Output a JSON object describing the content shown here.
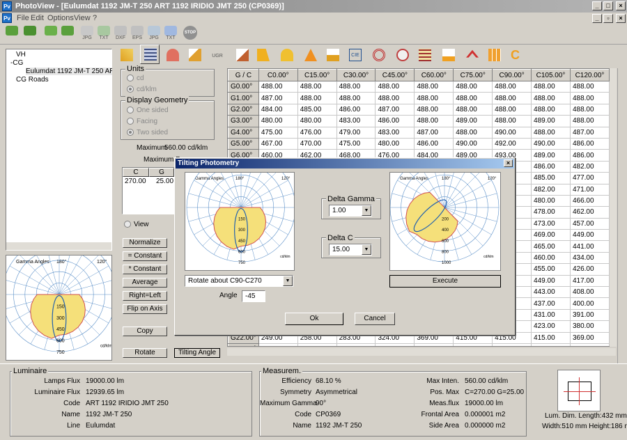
{
  "window": {
    "title": "PhotoView - [Eulumdat 1192 JM-T 250 ART 1192 IRIDIO JMT 250 (CP0369)]",
    "icon": "Pv"
  },
  "menu": [
    "File",
    "Edit",
    "Options",
    "View",
    "?"
  ],
  "toolbar": [
    {
      "icon": "user-green-icon",
      "label": ""
    },
    {
      "icon": "user-green-icon",
      "label": ""
    },
    {
      "icon": "users-icon",
      "label": ""
    },
    {
      "icon": "users-icon",
      "label": ""
    },
    {
      "icon": "export-jpg-icon",
      "label": "JPG"
    },
    {
      "icon": "export-txt-icon",
      "label": "TXT"
    },
    {
      "icon": "export-dxf-icon",
      "label": "DXF"
    },
    {
      "icon": "export-eps-icon",
      "label": "EPS"
    },
    {
      "icon": "export-jpg-icon",
      "label": "JPG"
    },
    {
      "icon": "export-txt-icon",
      "label": "TXT"
    },
    {
      "icon": "stop-icon",
      "label": "STOP"
    }
  ],
  "tree": {
    "items": [
      "VH",
      "CG",
      "Eulumdat 1192 JM-T 250 ART 1192",
      "CG Roads"
    ]
  },
  "units": {
    "title": "Units",
    "options": [
      "cd",
      "cd/klm"
    ]
  },
  "geometry": {
    "title": "Display Geometry",
    "options": [
      "One sided",
      "Facing",
      "Two sided"
    ]
  },
  "maximum": {
    "label": "Maximum",
    "value": "560.00 cd/klm",
    "pos_label": "Maximum Po"
  },
  "maxpos_table": {
    "headers": [
      "C",
      "G"
    ],
    "values": [
      "270.00",
      "25.00"
    ]
  },
  "view_label": "View",
  "side_buttons": [
    "Normalize",
    "= Constant",
    "* Constant",
    "Average",
    "Right=Left",
    "Flip on Axis",
    "Copy",
    "Rotate",
    "Tilting Angle"
  ],
  "grid": {
    "corner": "G / C",
    "columns": [
      "C0.00°",
      "C15.00°",
      "C30.00°",
      "C45.00°",
      "C60.00°",
      "C75.00°",
      "C90.00°",
      "C105.00°",
      "C120.00°"
    ],
    "rows": [
      {
        "g": "G0.00°",
        "v": [
          "488.00",
          "488.00",
          "488.00",
          "488.00",
          "488.00",
          "488.00",
          "488.00",
          "488.00",
          "488.00"
        ]
      },
      {
        "g": "G1.00°",
        "v": [
          "487.00",
          "488.00",
          "488.00",
          "488.00",
          "488.00",
          "488.00",
          "488.00",
          "488.00",
          "488.00"
        ]
      },
      {
        "g": "G2.00°",
        "v": [
          "484.00",
          "485.00",
          "486.00",
          "487.00",
          "488.00",
          "488.00",
          "488.00",
          "488.00",
          "488.00"
        ]
      },
      {
        "g": "G3.00°",
        "v": [
          "480.00",
          "480.00",
          "483.00",
          "486.00",
          "488.00",
          "489.00",
          "488.00",
          "489.00",
          "488.00"
        ]
      },
      {
        "g": "G4.00°",
        "v": [
          "475.00",
          "476.00",
          "479.00",
          "483.00",
          "487.00",
          "488.00",
          "490.00",
          "488.00",
          "487.00"
        ]
      },
      {
        "g": "G5.00°",
        "v": [
          "467.00",
          "470.00",
          "475.00",
          "480.00",
          "486.00",
          "490.00",
          "492.00",
          "490.00",
          "486.00"
        ]
      },
      {
        "g": "G6.00°",
        "v": [
          "460.00",
          "462.00",
          "468.00",
          "476.00",
          "484.00",
          "489.00",
          "493.00",
          "489.00",
          "486.00"
        ]
      },
      {
        "g": "",
        "v": [
          "",
          "",
          "",
          "",
          "",
          "",
          "",
          "486.00",
          "482.00"
        ]
      },
      {
        "g": "",
        "v": [
          "",
          "",
          "",
          "",
          "",
          "",
          "",
          "485.00",
          "477.00"
        ]
      },
      {
        "g": "",
        "v": [
          "",
          "",
          "",
          "",
          "",
          "",
          "",
          "482.00",
          "471.00"
        ]
      },
      {
        "g": "",
        "v": [
          "",
          "",
          "",
          "",
          "",
          "",
          "",
          "480.00",
          "466.00"
        ]
      },
      {
        "g": "",
        "v": [
          "",
          "",
          "",
          "",
          "",
          "",
          "",
          "478.00",
          "462.00"
        ]
      },
      {
        "g": "",
        "v": [
          "",
          "",
          "",
          "",
          "",
          "",
          "",
          "473.00",
          "457.00"
        ]
      },
      {
        "g": "",
        "v": [
          "",
          "",
          "",
          "",
          "",
          "",
          "",
          "469.00",
          "449.00"
        ]
      },
      {
        "g": "",
        "v": [
          "",
          "",
          "",
          "",
          "",
          "",
          "",
          "465.00",
          "441.00"
        ]
      },
      {
        "g": "",
        "v": [
          "",
          "",
          "",
          "",
          "",
          "",
          "",
          "460.00",
          "434.00"
        ]
      },
      {
        "g": "",
        "v": [
          "",
          "",
          "",
          "",
          "",
          "",
          "",
          "455.00",
          "426.00"
        ]
      },
      {
        "g": "",
        "v": [
          "",
          "",
          "",
          "",
          "",
          "",
          "",
          "449.00",
          "417.00"
        ]
      },
      {
        "g": "",
        "v": [
          "",
          "",
          "",
          "",
          "",
          "",
          "",
          "443.00",
          "408.00"
        ]
      },
      {
        "g": "",
        "v": [
          "",
          "",
          "",
          "",
          "",
          "",
          "",
          "437.00",
          "400.00"
        ]
      },
      {
        "g": "",
        "v": [
          "",
          "",
          "",
          "",
          "",
          "",
          "",
          "431.00",
          "391.00"
        ]
      },
      {
        "g": "",
        "v": [
          "",
          "",
          "",
          "",
          "",
          "",
          "",
          "423.00",
          "380.00"
        ]
      },
      {
        "g": "G22.00°",
        "v": [
          "249.00",
          "258.00",
          "283.00",
          "324.00",
          "369.00",
          "415.00",
          "415.00",
          "415.00",
          "369.00"
        ]
      },
      {
        "g": "G23.00°",
        "v": [
          "236.00",
          "245.00",
          "270.00",
          "311.00",
          "358.00",
          "408.00",
          "408.00",
          "407.00",
          "357.00"
        ]
      }
    ]
  },
  "polar": {
    "title": "Gamma Angles",
    "top_labels": [
      "180°",
      "120°"
    ],
    "angle_labels": [
      "105°",
      "90°",
      "75°",
      "60°",
      "45°",
      "30°",
      "15°",
      "0°"
    ],
    "radial_labels": [
      "150",
      "300",
      "450",
      "600",
      "750"
    ],
    "unit": "cd/klm"
  },
  "dialog": {
    "title": "Tilting Photometry",
    "delta_gamma": {
      "label": "Delta Gamma",
      "value": "1.00"
    },
    "delta_c": {
      "label": "Delta C",
      "value": "15.00"
    },
    "rotate": {
      "value": "Rotate about C90-C270"
    },
    "angle": {
      "label": "Angle",
      "value": "-45"
    },
    "execute": "Execute",
    "ok": "Ok",
    "cancel": "Cancel",
    "right_radial": [
      "200",
      "400",
      "600",
      "800",
      "1000"
    ]
  },
  "luminaire": {
    "title": "Luminaire",
    "fields": [
      {
        "k": "Lamps Flux",
        "v": "19000.00 lm"
      },
      {
        "k": "Luminaire Flux",
        "v": "12939.65 lm"
      },
      {
        "k": "Code",
        "v": "ART 1192 IRIDIO JMT 250"
      },
      {
        "k": "Name",
        "v": "1192 JM-T 250"
      },
      {
        "k": "Line",
        "v": "Eulumdat"
      }
    ]
  },
  "measurem": {
    "title": "Measurem.",
    "left": [
      {
        "k": "Efficiency",
        "v": "68.10 %"
      },
      {
        "k": "Symmetry",
        "v": "Asymmetrical"
      },
      {
        "k": "Maximum Gamma",
        "v": "90°"
      },
      {
        "k": "Code",
        "v": "CP0369"
      },
      {
        "k": "Name",
        "v": "1192 JM-T 250"
      }
    ],
    "right": [
      {
        "k": "Max Inten.",
        "v": "560.00 cd/klm"
      },
      {
        "k": "Pos. Max",
        "v": "C=270.00 G=25.00"
      },
      {
        "k": "Meas.flux",
        "v": "19000.00 lm"
      },
      {
        "k": "Frontal Area",
        "v": "0.000001 m2"
      },
      {
        "k": "Side Area",
        "v": "0.000000 m2"
      }
    ]
  },
  "dims": {
    "line1": "Lum. Dim.   Length:432 mm",
    "line2": "Width:510 mm Height:186 mm"
  },
  "colors": {
    "caption": "#0a246a",
    "polar_fill": "#f5e07a",
    "polar_line": "#d05050",
    "grid_line": "#5a8fc8"
  }
}
